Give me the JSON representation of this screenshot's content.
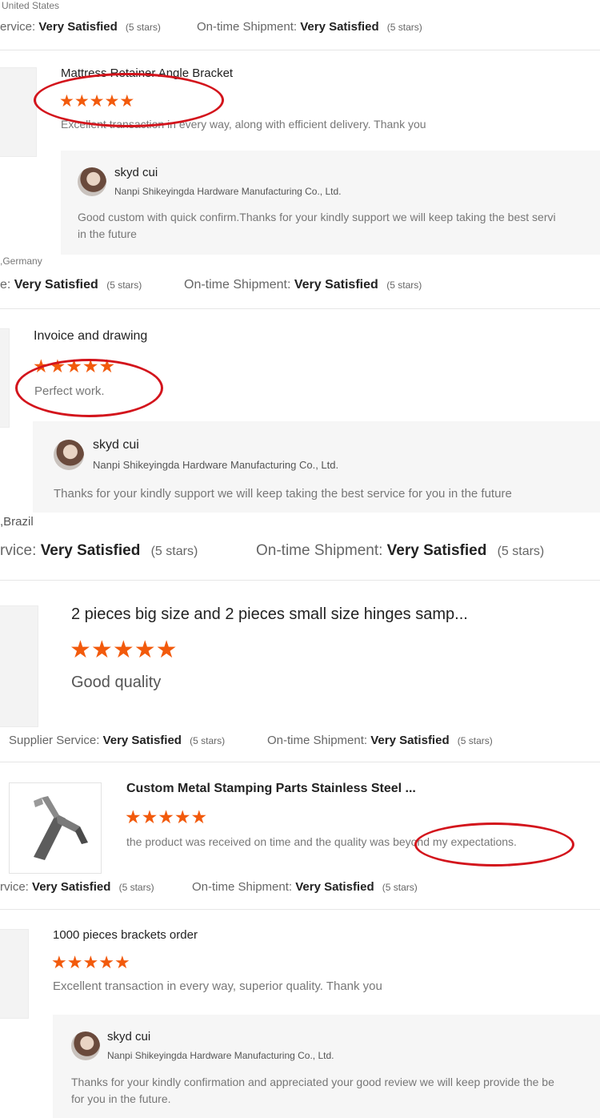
{
  "colors": {
    "star": "#f25a0c",
    "annotation": "#d3141c",
    "separator": "#e6e6e6"
  },
  "icons": {
    "star": "star-icon",
    "avatar": "avatar-photo"
  },
  "reviews": [
    {
      "country": "United States",
      "supplier_label": "ervice: ",
      "supplier_value": "Very Satisfied",
      "supplier_count": "(5 stars)",
      "ship_label": "On-time Shipment: ",
      "ship_value": "Very Satisfied",
      "ship_count": "(5 stars)"
    },
    {
      "title": "Mattress Retainer Angle Bracket",
      "stars": 5,
      "comment": "Excellent transaction in every way, along with efficient delivery. Thank you",
      "reply": {
        "name": "skyd cui",
        "company": "Nanpi Shikeyingda Hardware Manufacturing Co., Ltd.",
        "text": "Good custom with quick confirm.Thanks for your kindly support we will keep taking the best servi",
        "text2": "in the future"
      },
      "country": "Germany",
      "country_prefix": ",",
      "supplier_label": "e: ",
      "supplier_value": "Very Satisfied",
      "supplier_count": "(5 stars)",
      "ship_label": "On-time Shipment: ",
      "ship_value": "Very Satisfied",
      "ship_count": "(5 stars)"
    },
    {
      "title": "Invoice and drawing",
      "stars": 5,
      "comment": "Perfect work.",
      "reply": {
        "name": "skyd cui",
        "company": "Nanpi Shikeyingda Hardware Manufacturing Co., Ltd.",
        "text": "Thanks for your kindly support we will keep taking the best service for you in the future"
      },
      "country": "Brazil",
      "country_prefix": ",",
      "supplier_label": "rvice: ",
      "supplier_value": "Very Satisfied",
      "supplier_count": "(5 stars)",
      "ship_label": "On-time Shipment: ",
      "ship_value": "Very Satisfied",
      "ship_count": "(5 stars)"
    },
    {
      "title": "2 pieces big size and 2 pieces small size hinges samp...",
      "stars": 5,
      "comment": "Good quality",
      "supplier_label": "Supplier Service: ",
      "supplier_value": "Very Satisfied",
      "supplier_count": "(5 stars)",
      "ship_label": "On-time Shipment: ",
      "ship_value": "Very Satisfied",
      "ship_count": "(5 stars)"
    },
    {
      "title": "Custom Metal Stamping Parts Stainless Steel ...",
      "stars": 5,
      "comment": "the product was received on time and the quality was beyond my expectations.",
      "supplier_label": "rvice: ",
      "supplier_value": "Very Satisfied",
      "supplier_count": "(5 stars)",
      "ship_label": "On-time Shipment: ",
      "ship_value": "Very Satisfied",
      "ship_count": "(5 stars)"
    },
    {
      "title": "1000 pieces brackets order",
      "stars": 5,
      "comment": "Excellent transaction in every way, superior quality.  Thank you",
      "reply": {
        "name": "skyd cui",
        "company": "Nanpi Shikeyingda Hardware Manufacturing Co., Ltd.",
        "text": "Thanks for your kindly confirmation and appreciated your good review we will keep provide the be",
        "text2": "for you in the future."
      }
    }
  ]
}
